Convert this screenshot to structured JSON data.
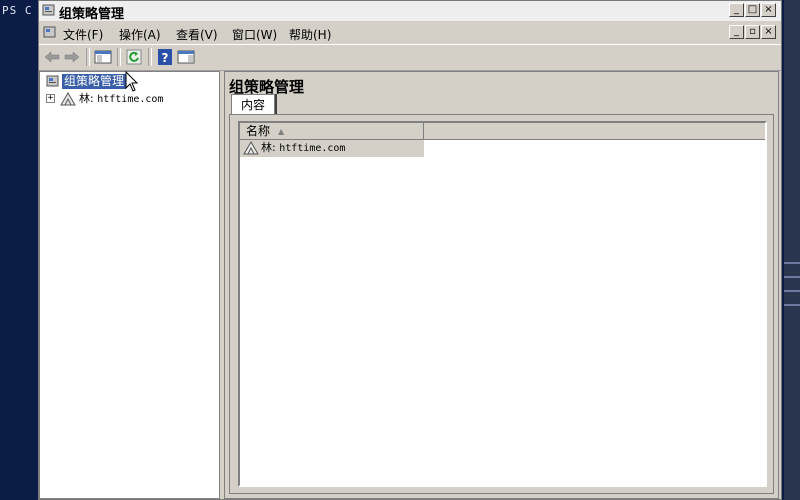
{
  "background": {
    "terminal_text": "PS C"
  },
  "window": {
    "title": "组策略管理",
    "controls": {
      "minimize": "_",
      "maximize": "□",
      "close": "×"
    },
    "mdi_controls": {
      "minimize": "_",
      "restore": "▫",
      "close": "×"
    }
  },
  "menu": {
    "items": [
      {
        "label": "文件(F)"
      },
      {
        "label": "操作(A)"
      },
      {
        "label": "查看(V)"
      },
      {
        "label": "窗口(W)"
      },
      {
        "label": "帮助(H)"
      }
    ]
  },
  "toolbar": {
    "buttons": [
      "back-arrow",
      "forward-arrow",
      "show-hide-tree",
      "refresh",
      "help",
      "show-action-pane"
    ]
  },
  "tree": {
    "root_label": "组策略管理",
    "child": {
      "prefix": "林:",
      "domain": "htftime.com",
      "expander": "+"
    }
  },
  "right_pane": {
    "title": "组策略管理",
    "tab_label": "内容",
    "list": {
      "column_header": "名称",
      "rows": [
        {
          "prefix": "林:",
          "domain": "htftime.com"
        }
      ]
    }
  },
  "colors": {
    "selection": "#3a5fa8",
    "window_face": "#d4d0c8",
    "desktop": "#0b1d47"
  }
}
